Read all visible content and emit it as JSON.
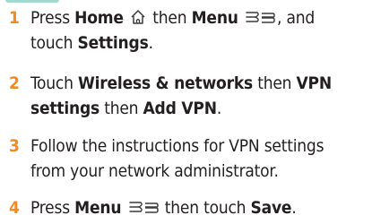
{
  "steps": [
    {
      "number": "1",
      "parts": {
        "a": "Press ",
        "b": "Home",
        "c": " then ",
        "d": "Menu",
        "e": ", and",
        "f": "touch ",
        "g": "Settings",
        "h": "."
      },
      "icons": [
        "home-icon",
        "menu-icon"
      ]
    },
    {
      "number": "2",
      "parts": {
        "a": "Touch ",
        "b": "Wireless & networks",
        "c": " then ",
        "d": "VPN",
        "e": "settings",
        "f": " then ",
        "g": "Add VPN",
        "h": "."
      }
    },
    {
      "number": "3",
      "line1": "Follow the instructions for VPN settings",
      "line2": "from your network administrator."
    },
    {
      "number": "4",
      "parts": {
        "a": "Press ",
        "b": "Menu",
        "c": " then touch ",
        "d": "Save",
        "e": "."
      },
      "icons": [
        "menu-icon"
      ]
    }
  ],
  "colors": {
    "step_number": "#f08a24",
    "text": "#231f20",
    "icon_stroke": "#3a3a3a"
  }
}
